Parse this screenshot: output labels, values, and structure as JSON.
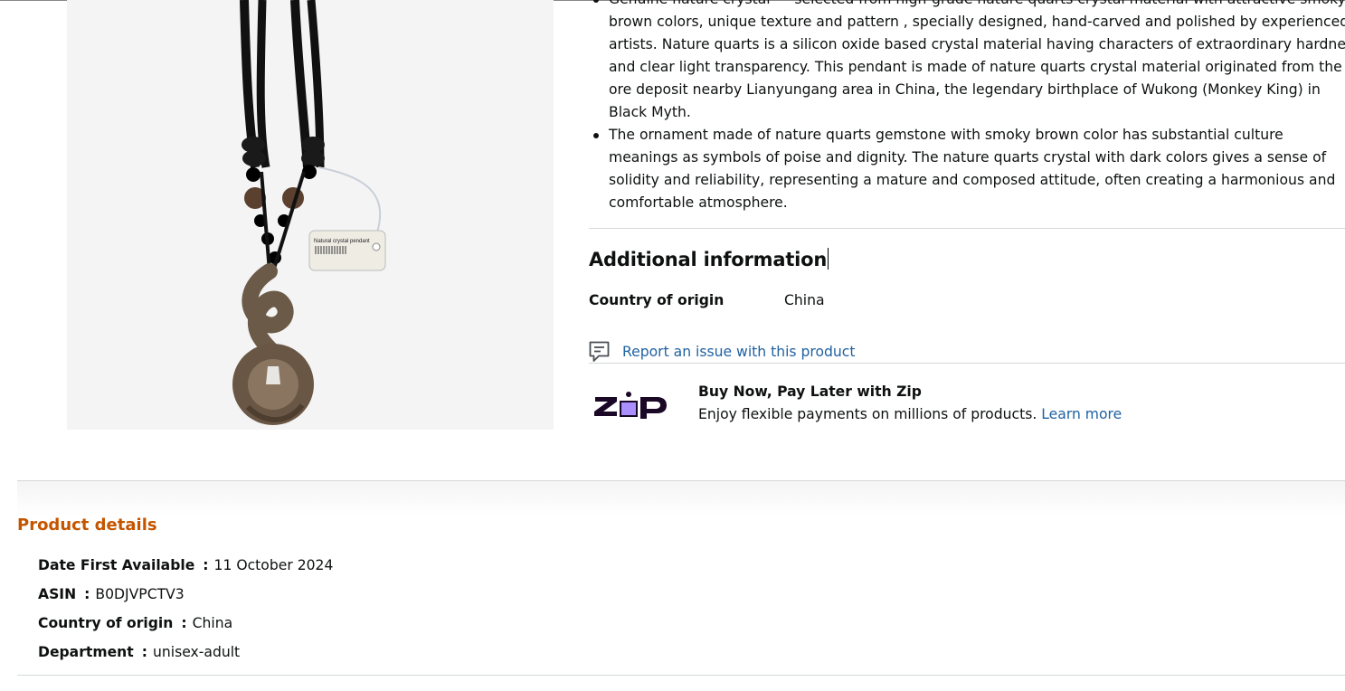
{
  "bullets": [
    {
      "lines": [
        "Genuine nature crystal --- selected from high-grade nature quarts crystal material with attractive smoky",
        "brown colors, unique texture and pattern , specially designed, hand-carved and polished by experienced",
        "artists. Nature quarts is a silicon oxide based crystal material having characters of extraordinary hardness",
        "and clear light transparency. This pendant is made of nature quarts crystal material originated from the",
        "ore deposit nearby Lianyungang area in China, the legendary birthplace of Wukong (Monkey King) in",
        "Black Myth."
      ]
    },
    {
      "lines": [
        "The ornament made of nature quarts gemstone with smoky brown color has substantial culture",
        "meanings as symbols of poise and dignity. The nature quarts crystal with dark colors gives a sense of",
        "solidity and reliability, representing a mature and composed attitude, often creating a harmonious and",
        "comfortable atmosphere."
      ]
    }
  ],
  "product_image": {
    "tag_text": "Natural crystal pendant"
  },
  "additional_info": {
    "title": "Additional information",
    "rows": [
      {
        "label": "Country of origin",
        "value": "China"
      }
    ]
  },
  "report": {
    "label": "Report an issue with this product",
    "icon": "feedback-icon"
  },
  "zip": {
    "logo_text": "ZIP",
    "title": "Buy Now, Pay Later with Zip",
    "description": "Enjoy flexible payments on millions of products.",
    "link": "Learn more"
  },
  "product_details": {
    "title": "Product details",
    "items": [
      {
        "key": "Date First Available",
        "value": "11 October 2024"
      },
      {
        "key": "ASIN",
        "value": "B0DJVPCTV3"
      },
      {
        "key": "Country of origin",
        "value": "China"
      },
      {
        "key": "Department",
        "value": "unisex-adult"
      }
    ],
    "separator": ":"
  },
  "colors": {
    "link": "#2162a1",
    "section_title": "#c45500",
    "zip_purple": "#aa8fff",
    "text": "#0f1111"
  }
}
